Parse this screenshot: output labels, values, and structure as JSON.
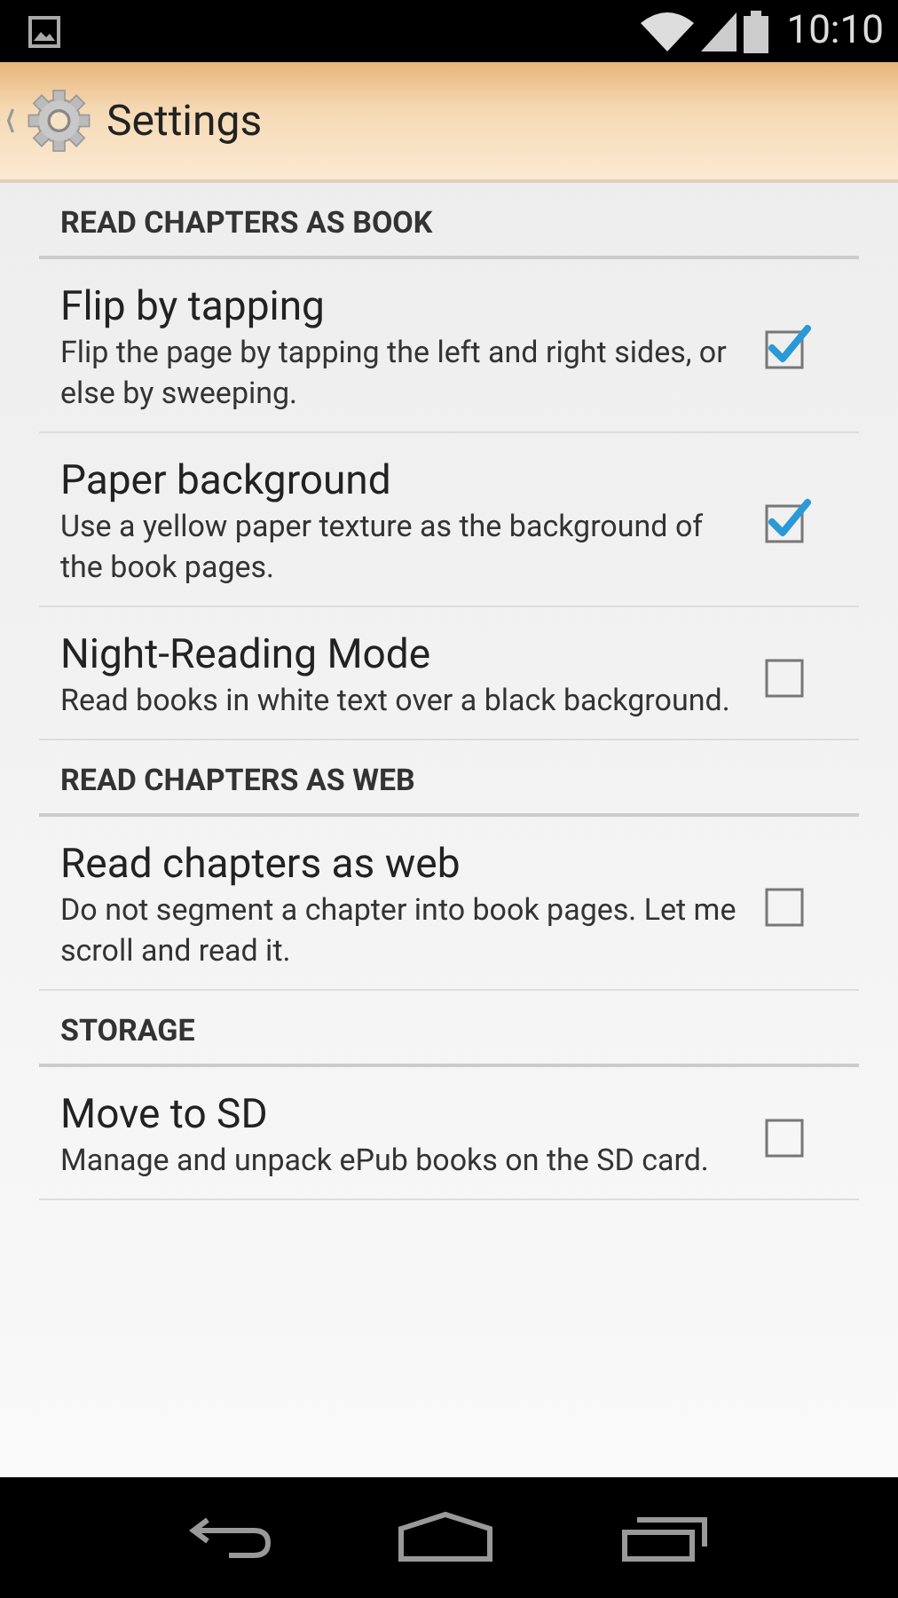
{
  "status_bar": {
    "time": "10:10"
  },
  "action_bar": {
    "title": "Settings"
  },
  "sections": [
    {
      "title": "READ CHAPTERS AS BOOK",
      "items": [
        {
          "title": "Flip by tapping",
          "summary": "Flip the page by tapping the left and right sides, or else by sweeping.",
          "checked": true
        },
        {
          "title": "Paper background",
          "summary": "Use a yellow paper texture as the background of the book pages.",
          "checked": true
        },
        {
          "title": "Night-Reading Mode",
          "summary": "Read books in white text over a black background.",
          "checked": false
        }
      ]
    },
    {
      "title": "READ CHAPTERS AS WEB",
      "items": [
        {
          "title": "Read chapters as web",
          "summary": "Do not segment a chapter into book pages. Let me scroll and read it.",
          "checked": false
        }
      ]
    },
    {
      "title": "STORAGE",
      "items": [
        {
          "title": "Move to SD",
          "summary": "Manage and unpack ePub books on the SD card.",
          "checked": false
        }
      ]
    }
  ]
}
